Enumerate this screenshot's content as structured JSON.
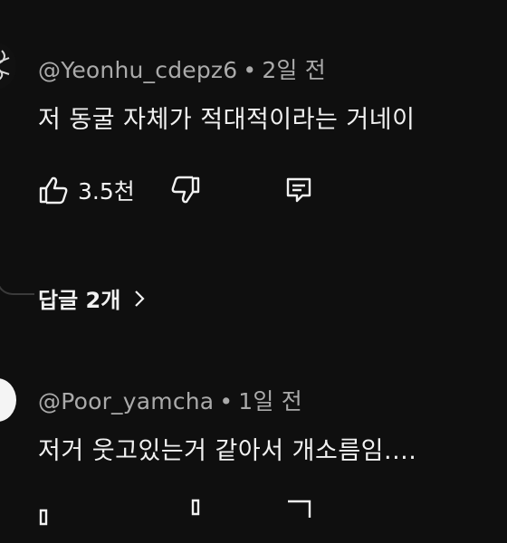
{
  "comments": [
    {
      "author": "@Yeonhu_cdepz6",
      "separator": "•",
      "time": "2일 전",
      "text": "저 동굴 자체가 적대적이라는 거네이",
      "like_count": "3.5천",
      "replies_label": "답글 2개"
    },
    {
      "author": "@Poor_yamcha",
      "separator": "•",
      "time": "1일 전",
      "text": "저거 웃고있는거 같아서 개소름임...."
    }
  ],
  "colors": {
    "background": "#0f0f0f",
    "primary_text": "#f1f1f1",
    "secondary_text": "#aaaaaa"
  },
  "icons": [
    "like-icon",
    "dislike-icon",
    "reply-icon",
    "chevron-right-icon"
  ]
}
